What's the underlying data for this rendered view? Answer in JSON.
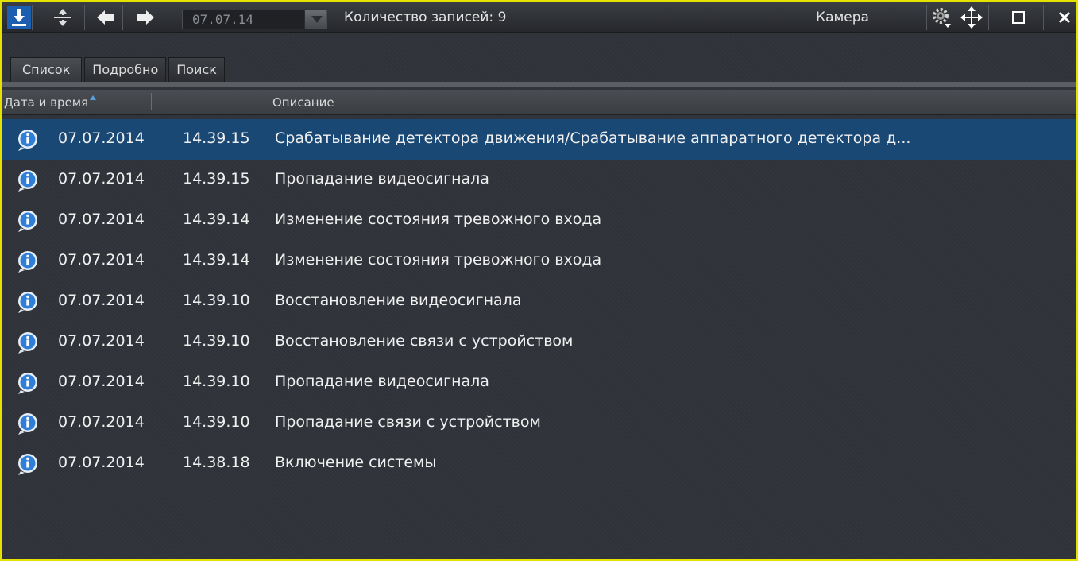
{
  "toolbar": {
    "date_value": "07.07.14",
    "records_label": "Количество записей: 9",
    "camera_label": "Камера",
    "icons": [
      "download-icon",
      "split-icon",
      "arrow-left-icon",
      "arrow-right-icon",
      "gear-icon",
      "move-icon",
      "maximize-icon",
      "close-icon"
    ]
  },
  "tabs": [
    {
      "label": "Список",
      "active": true
    },
    {
      "label": "Подробно",
      "active": false
    },
    {
      "label": "Поиск",
      "active": false
    }
  ],
  "columns": {
    "datetime": "Дата и время",
    "description": "Описание"
  },
  "rows": [
    {
      "date": "07.07.2014",
      "time": "14.39.15",
      "desc": "Срабатывание детектора движения/Срабатывание аппаратного детектора д...",
      "selected": true
    },
    {
      "date": "07.07.2014",
      "time": "14.39.15",
      "desc": "Пропадание видеосигнала"
    },
    {
      "date": "07.07.2014",
      "time": "14.39.14",
      "desc": "Изменение состояния тревожного входа"
    },
    {
      "date": "07.07.2014",
      "time": "14.39.14",
      "desc": "Изменение состояния тревожного входа"
    },
    {
      "date": "07.07.2014",
      "time": "14.39.10",
      "desc": "Восстановление видеосигнала"
    },
    {
      "date": "07.07.2014",
      "time": "14.39.10",
      "desc": "Восстановление связи с устройством"
    },
    {
      "date": "07.07.2014",
      "time": "14.39.10",
      "desc": "Пропадание видеосигнала"
    },
    {
      "date": "07.07.2014",
      "time": "14.39.10",
      "desc": "Пропадание связи с устройством"
    },
    {
      "date": "07.07.2014",
      "time": "14.38.18",
      "desc": "Включение системы"
    }
  ],
  "colors": {
    "frame": "#e6e200",
    "selected_row": "#1a4874",
    "info_icon": "#2f7fd8"
  }
}
